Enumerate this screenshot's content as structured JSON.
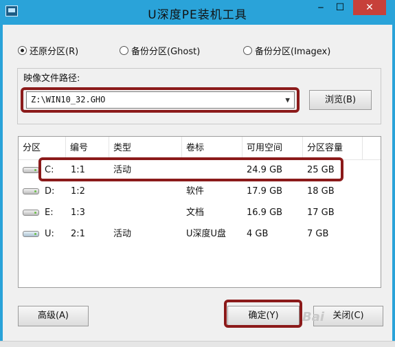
{
  "window": {
    "title": "U深度PE装机工具"
  },
  "modes": [
    {
      "label": "还原分区(R)",
      "selected": true
    },
    {
      "label": "备份分区(Ghost)",
      "selected": false
    },
    {
      "label": "备份分区(Imagex)",
      "selected": false
    }
  ],
  "image_path": {
    "label": "映像文件路径:",
    "value": "Z:\\WIN10_32.GHO",
    "browse_label": "浏览(B)"
  },
  "table": {
    "headers": [
      "分区",
      "编号",
      "类型",
      "卷标",
      "可用空间",
      "分区容量"
    ],
    "rows": [
      {
        "part": "C:",
        "num": "1:1",
        "type": "活动",
        "label": "",
        "free": "24.9 GB",
        "size": "25 GB",
        "icon": "hard-disk-icon"
      },
      {
        "part": "D:",
        "num": "1:2",
        "type": "",
        "label": "软件",
        "free": "17.9 GB",
        "size": "18 GB",
        "icon": "hard-disk-icon"
      },
      {
        "part": "E:",
        "num": "1:3",
        "type": "",
        "label": "文档",
        "free": "16.9 GB",
        "size": "17 GB",
        "icon": "hard-disk-icon"
      },
      {
        "part": "U:",
        "num": "2:1",
        "type": "活动",
        "label": "U深度U盘",
        "free": "4 GB",
        "size": "7 GB",
        "icon": "usb-disk-icon"
      }
    ]
  },
  "buttons": {
    "advanced": "高级(A)",
    "ok": "确定(Y)",
    "close": "关闭(C)"
  },
  "watermark": "Bai"
}
